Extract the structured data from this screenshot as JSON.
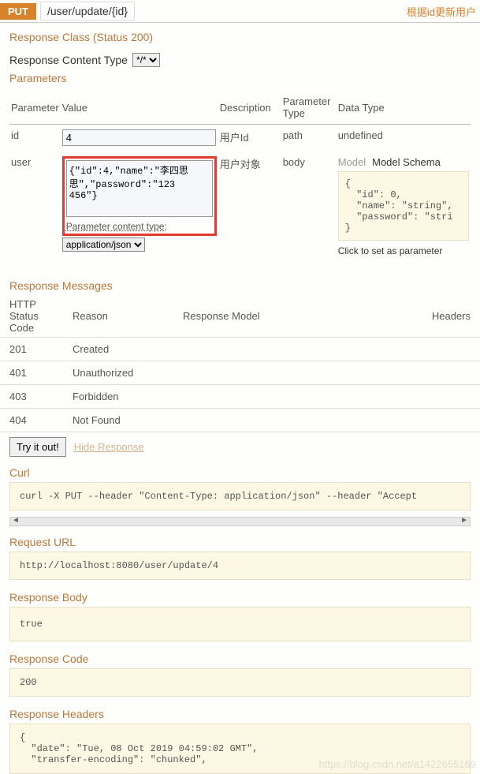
{
  "header": {
    "method": "PUT",
    "path": "/user/update/{id}",
    "description": "根据id更新用户"
  },
  "response_class": {
    "heading": "Response Class (Status 200)",
    "content_type_label": "Response Content Type",
    "content_type_selected": "*/*"
  },
  "parameters": {
    "heading": "Parameters",
    "columns": {
      "name": "Parameter",
      "value": "Value",
      "desc": "Description",
      "ptype": "Parameter Type",
      "dtype": "Data Type"
    },
    "rows": [
      {
        "name": "id",
        "value": "4",
        "desc": "用户Id",
        "ptype": "path",
        "dtype": "undefined"
      },
      {
        "name": "user",
        "value": "{\"id\":4,\"name\":\"李四思\n思\",\"password\":\"123\n456\"}",
        "desc": "用户对象",
        "ptype": "body",
        "model_tab": "Model",
        "schema_tab": "Model Schema",
        "schema": "{\n  \"id\": 0,\n  \"name\": \"string\",\n  \"password\": \"stri\n}",
        "schema_hint": "Click to set as parameter",
        "param_content_type_label": "Parameter content type:",
        "param_content_type_selected": "application/json"
      }
    ]
  },
  "response_messages": {
    "heading": "Response Messages",
    "columns": {
      "code": "HTTP Status Code",
      "reason": "Reason",
      "model": "Response Model",
      "headers": "Headers"
    },
    "rows": [
      {
        "code": "201",
        "reason": "Created"
      },
      {
        "code": "401",
        "reason": "Unauthorized"
      },
      {
        "code": "403",
        "reason": "Forbidden"
      },
      {
        "code": "404",
        "reason": "Not Found"
      }
    ]
  },
  "actions": {
    "try_it": "Try it out!",
    "hide": "Hide Response"
  },
  "results": {
    "curl_heading": "Curl",
    "curl": "curl -X PUT --header \"Content-Type: application/json\" --header \"Accept",
    "request_url_heading": "Request URL",
    "request_url": "http://localhost:8080/user/update/4",
    "body_heading": "Response Body",
    "body": "true",
    "code_heading": "Response Code",
    "code": "200",
    "headers_heading": "Response Headers",
    "headers": "{\n  \"date\": \"Tue, 08 Oct 2019 04:59:02 GMT\",\n  \"transfer-encoding\": \"chunked\","
  },
  "watermark": "https://blog.csdn.net/a1422655169"
}
